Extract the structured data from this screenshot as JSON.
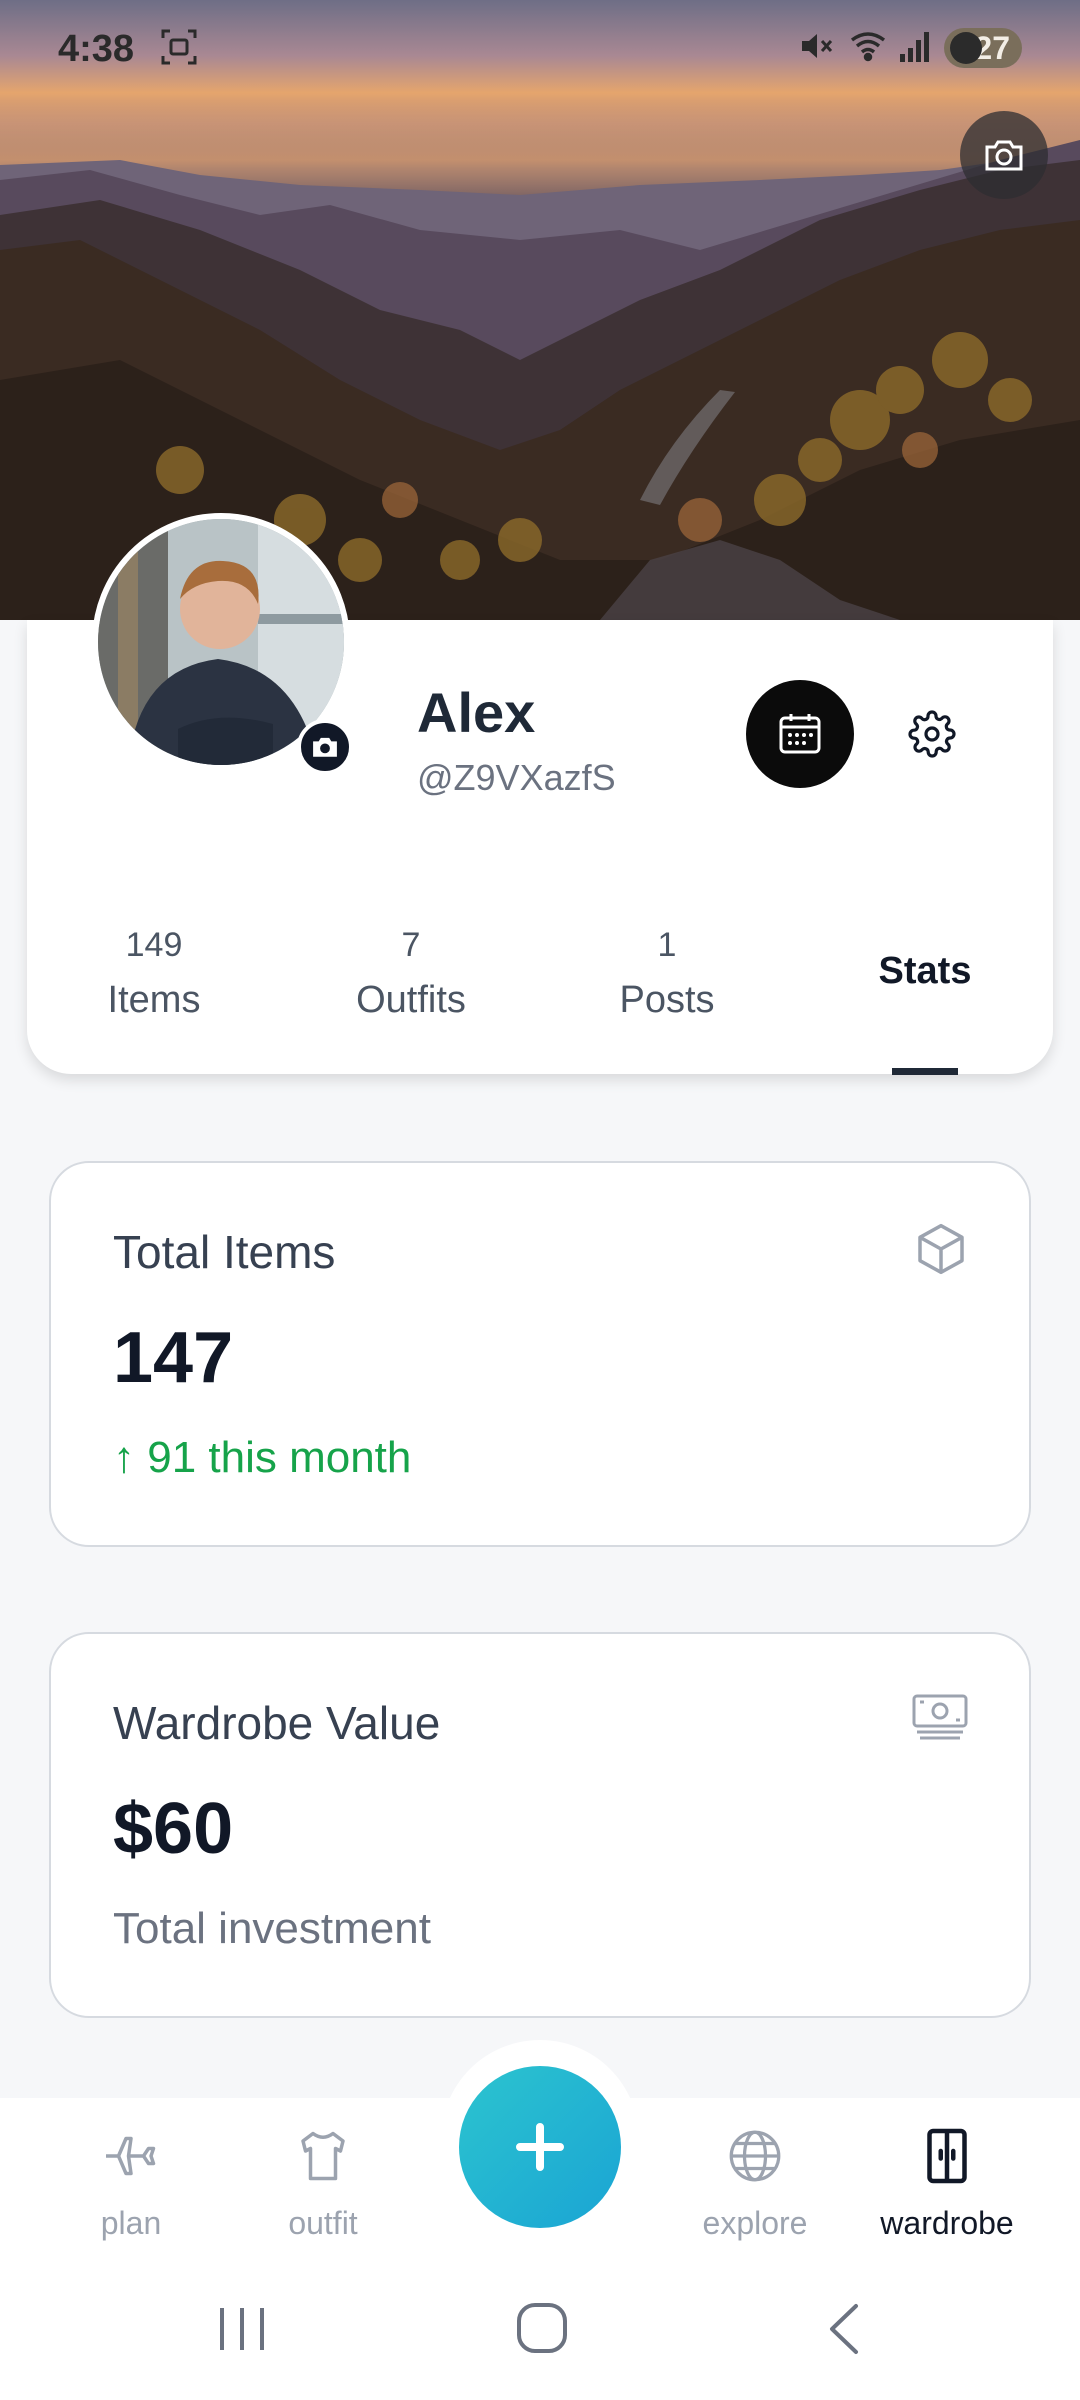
{
  "status_bar": {
    "time": "4:38",
    "battery": "27"
  },
  "profile": {
    "name": "Alex",
    "handle": "@Z9VXazfS"
  },
  "profile_stats": [
    {
      "count": "149",
      "label": "Items"
    },
    {
      "count": "7",
      "label": "Outfits"
    },
    {
      "count": "1",
      "label": "Posts"
    }
  ],
  "active_tab": "Stats",
  "cards": {
    "total_items": {
      "title": "Total Items",
      "value": "147",
      "sub": "↑ 91 this month",
      "icon": "cube-icon"
    },
    "wardrobe_value": {
      "title": "Wardrobe Value",
      "value": "$60",
      "sub": "Total investment",
      "icon": "money-icon"
    }
  },
  "bottom_nav": {
    "items": [
      {
        "label": "plan",
        "icon": "airplane-icon"
      },
      {
        "label": "outfit",
        "icon": "shirt-icon"
      },
      {
        "label": "explore",
        "icon": "globe-icon"
      },
      {
        "label": "wardrobe",
        "icon": "wardrobe-icon"
      }
    ],
    "active": "wardrobe"
  },
  "colors": {
    "accent_fab": "#1fb5d1",
    "positive": "#16a34a",
    "dark": "#111827"
  }
}
